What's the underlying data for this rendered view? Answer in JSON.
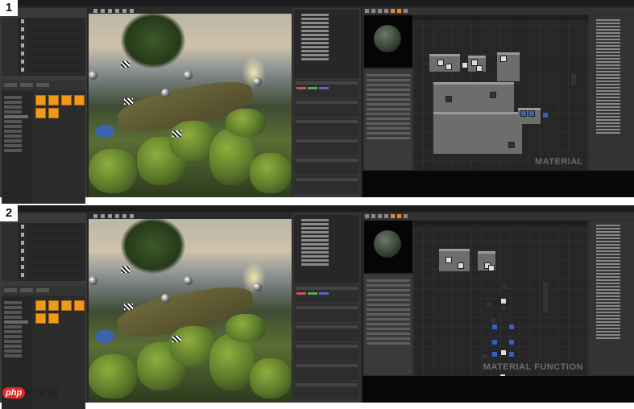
{
  "screenshots": [
    {
      "number": "1",
      "graph_label": "MATERIAL",
      "editor_type": "material"
    },
    {
      "number": "2",
      "graph_label": "MATERIAL FUNCTION",
      "editor_type": "material-function"
    }
  ],
  "watermark": {
    "logo": "php",
    "text": "中文网"
  },
  "colors": {
    "asset_orange": "#f09a1a",
    "editor_bg": "#232323"
  }
}
